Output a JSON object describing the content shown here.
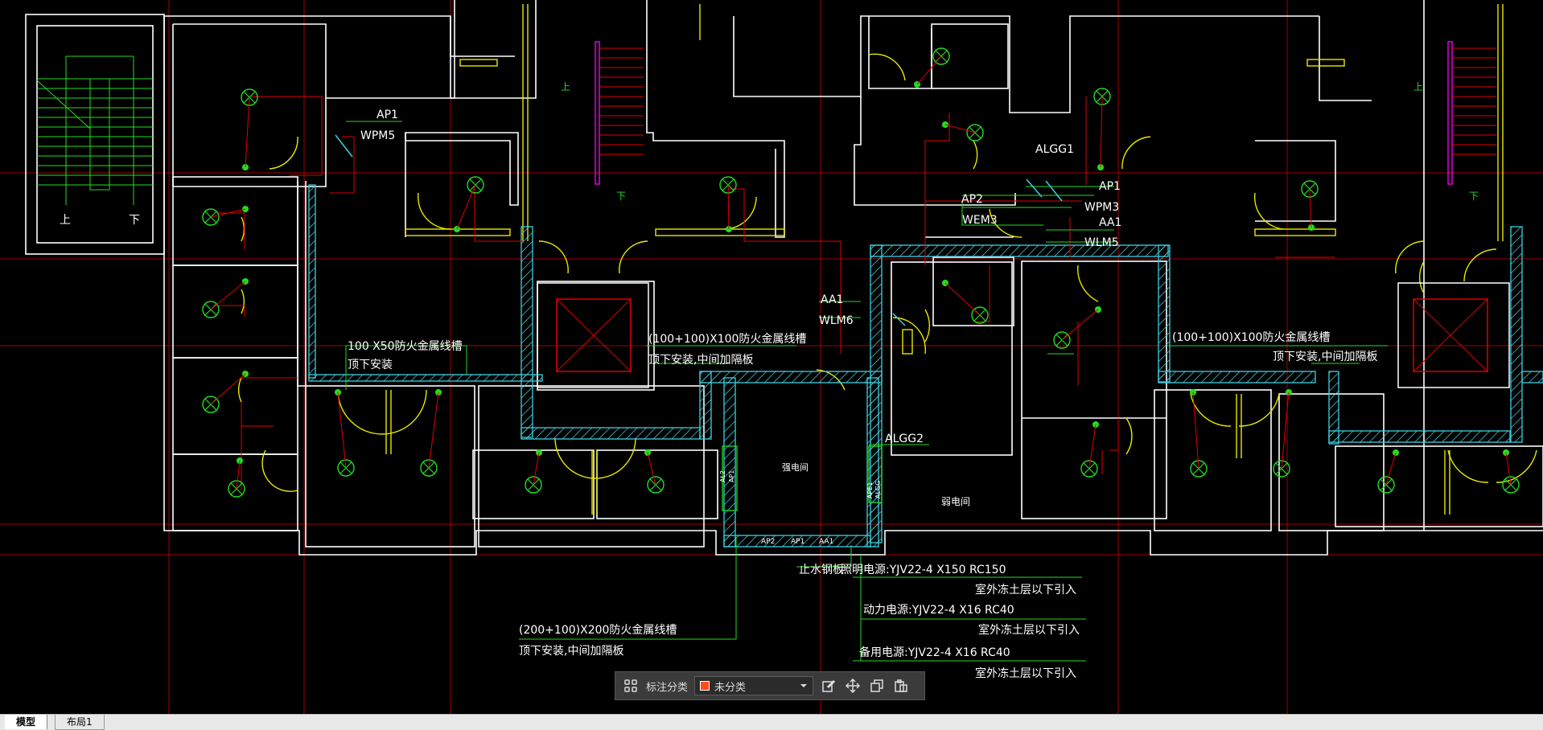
{
  "drawing": {
    "labels": {
      "ap1_left": "AP1",
      "wpm5": "WPM5",
      "tray_left_1": "100 X50防火金属线槽",
      "tray_left_2": "顶下安装",
      "tray_mid_1": "(100+100)X100防火金属线槽",
      "tray_mid_2": "顶下安装,中间加隔板",
      "tray_right_1": "(100+100)X100防火金属线槽",
      "tray_right_2": "顶下安装,中间加隔板",
      "tray_bottom_1": "(200+100)X200防火金属线槽",
      "tray_bottom_2": "顶下安装,中间加隔板",
      "algg1": "ALGG1",
      "ap2": "AP2",
      "wem3": "WEM3",
      "ap1_right": "AP1",
      "wpm3": "WPM3",
      "aa1_right": "AA1",
      "wlm5": "WLM5",
      "aa1_mid": "AA1",
      "wlm6": "WLM6",
      "algg2": "ALGG2",
      "room_strong": "强电间",
      "room_weak": "弱电间",
      "ap2_b": "AP2",
      "ap1_b": "AP1",
      "aa1_b": "AA1",
      "stop_plate": "止水钢板",
      "light_power": "照明电源:YJV22-4 X150  RC150",
      "outdoor_1": "室外冻土层以下引入",
      "power_supply": "动力电源:YJV22-4 X16  RC40",
      "outdoor_2": "室外冻土层以下引入",
      "backup_power": "备用电源:YJV22-4 X16  RC40",
      "outdoor_3": "室外冻土层以下引入",
      "stair_up": "上",
      "stair_down": "下",
      "stair_up_2": "上",
      "stair_up_3": "上",
      "stair_down_2": "下",
      "stair_down_3": "下",
      "vert_1": "AL2",
      "vert_2": "AP1",
      "vert_3": "APE1",
      "vert_4": "ALGG"
    }
  },
  "toolbar": {
    "grid_icon": "grid-icon",
    "category_label": "标注分类",
    "category_value": "未分类",
    "category_color": "#ff4a1e",
    "icons": [
      "edit-icon",
      "move-icon",
      "copy-icon",
      "paste-icon"
    ]
  },
  "tabs": {
    "model": "模型",
    "layout1": "布局1"
  }
}
